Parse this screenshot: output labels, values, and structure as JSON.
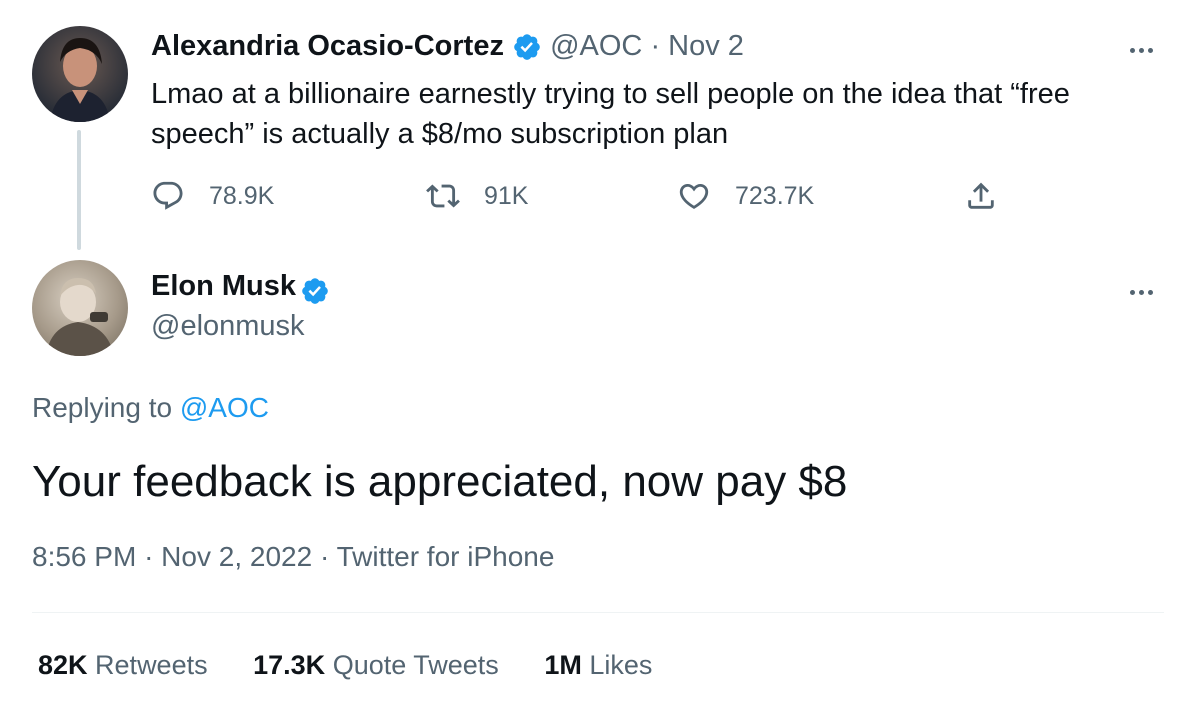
{
  "parent_tweet": {
    "author_name": "Alexandria Ocasio-Cortez",
    "handle": "@AOC",
    "separator": "·",
    "date": "Nov 2",
    "text": "Lmao at a billionaire earnestly trying to sell people on the idea that “free speech” is actually a $8/mo subscription plan",
    "actions": {
      "replies": "78.9K",
      "retweets": "91K",
      "likes": "723.7K"
    }
  },
  "main_tweet": {
    "author_name": "Elon Musk",
    "handle": "@elonmusk",
    "replying_prefix": "Replying to",
    "replying_to": "@AOC",
    "text": "Your feedback is appreciated, now pay $8",
    "time": "8:56 PM",
    "date": "Nov 2, 2022",
    "source": "Twitter for iPhone",
    "dot": "·"
  },
  "stats": {
    "retweets_count": "82K",
    "retweets_label": "Retweets",
    "quotes_count": "17.3K",
    "quotes_label": "Quote Tweets",
    "likes_count": "1M",
    "likes_label": "Likes"
  },
  "colors": {
    "verified": "#1d9bf0",
    "link": "#1d9bf0",
    "muted": "#536471",
    "text": "#0f1419"
  }
}
